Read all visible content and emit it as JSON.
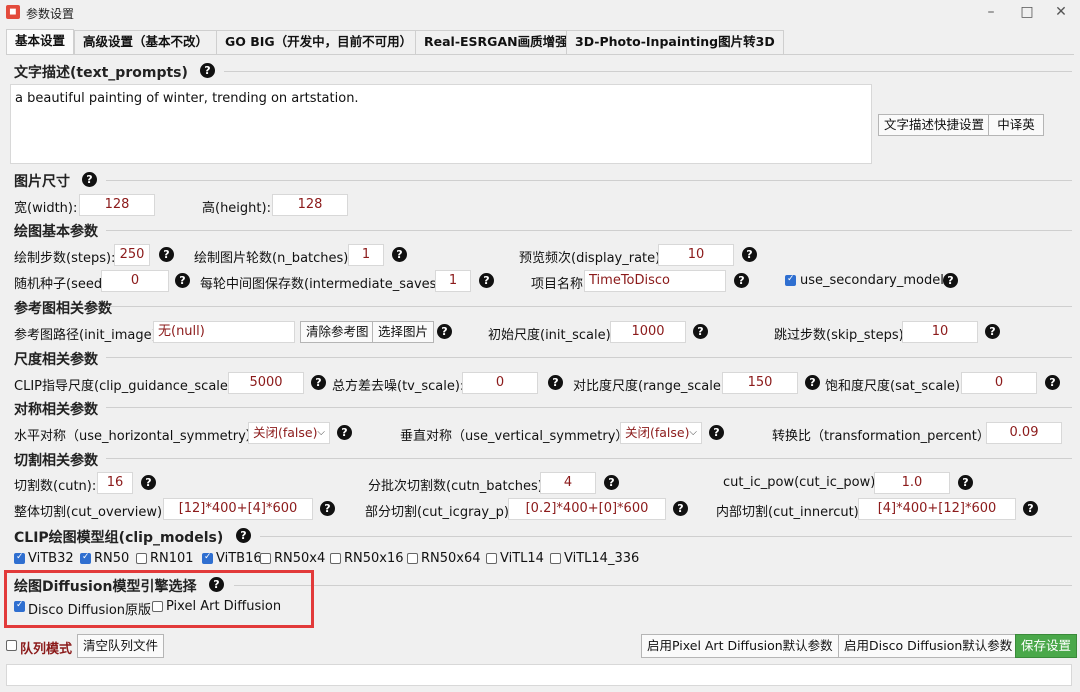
{
  "window": {
    "title": "参数设置"
  },
  "tabs": [
    {
      "label": "基本设置"
    },
    {
      "label": "高级设置（基本不改）"
    },
    {
      "label": "GO BIG（开发中，目前不可用）"
    },
    {
      "label": "Real-ESRGAN画质增强"
    },
    {
      "label": "3D-Photo-Inpainting图片转3D"
    }
  ],
  "text_prompts": {
    "title": "文字描述(text_prompts)",
    "value": "a beautiful painting of winter, trending on artstation.",
    "quick_btn": "文字描述快捷设置",
    "translate_btn": "中译英"
  },
  "image_size": {
    "title": "图片尺寸",
    "width_label": "宽(width):",
    "width": "128",
    "height_label": "高(height):",
    "height": "128"
  },
  "basic": {
    "title": "绘图基本参数",
    "steps_label": "绘制步数(steps):",
    "steps": "250",
    "n_batches_label": "绘制图片轮数(n_batches):",
    "n_batches": "1",
    "display_rate_label": "预览频次(display_rate):",
    "display_rate": "10",
    "seed_label": "随机种子(seed):",
    "seed": "0",
    "intermediate_label": "每轮中间图保存数(intermediate_saves):",
    "intermediate": "1",
    "project_label": "项目名称",
    "project": "TimeToDisco",
    "secondary_label": "use_secondary_model"
  },
  "init": {
    "title": "参考图相关参数",
    "path_label": "参考图路径(init_image):",
    "path": "无(null)",
    "clear_btn": "清除参考图",
    "select_btn": "选择图片",
    "scale_label": "初始尺度(init_scale):",
    "scale": "1000",
    "skip_label": "跳过步数(skip_steps):",
    "skip": "10"
  },
  "scales": {
    "title": "尺度相关参数",
    "clip_label": "CLIP指导尺度(clip_guidance_scale):",
    "clip": "5000",
    "tv_label": "总方差去噪(tv_scale):",
    "tv": "0",
    "range_label": "对比度尺度(range_scale):",
    "range": "150",
    "sat_label": "饱和度尺度(sat_scale):",
    "sat": "0"
  },
  "symmetry": {
    "title": "对称相关参数",
    "h_label": "水平对称（use_horizontal_symmetry）",
    "h_value": "关闭(false)",
    "v_label": "垂直对称（use_vertical_symmetry）",
    "v_value": "关闭(false)",
    "t_label": "转换比（transformation_percent）",
    "t_value": "0.09"
  },
  "cuts": {
    "title": "切割相关参数",
    "cutn_label": "切割数(cutn):",
    "cutn": "16",
    "batches_label": "分批次切割数(cutn_batches):",
    "batches": "4",
    "pow_label": "cut_ic_pow(cut_ic_pow):",
    "pow": "1.0",
    "overview_label": "整体切割(cut_overview):",
    "overview": "[12]*400+[4]*600",
    "icgray_label": "部分切割(cut_icgray_p):",
    "icgray": "[0.2]*400+[0]*600",
    "innercut_label": "内部切割(cut_innercut):",
    "innercut": "[4]*400+[12]*600"
  },
  "clip_models": {
    "title": "CLIP绘图模型组(clip_models)",
    "items": [
      {
        "label": "ViTB32",
        "checked": true
      },
      {
        "label": "RN50",
        "checked": true
      },
      {
        "label": "RN101",
        "checked": false
      },
      {
        "label": "ViTB16",
        "checked": true
      },
      {
        "label": "RN50x4",
        "checked": false
      },
      {
        "label": "RN50x16",
        "checked": false
      },
      {
        "label": "RN50x64",
        "checked": false
      },
      {
        "label": "ViTL14",
        "checked": false
      },
      {
        "label": "ViTL14_336",
        "checked": false
      }
    ]
  },
  "diffusion": {
    "title": "绘图Diffusion模型引擎选择",
    "disco_label": "Disco Diffusion原版",
    "disco_checked": true,
    "pixel_label": "Pixel Art Diffusion",
    "pixel_checked": false
  },
  "bottom": {
    "queue_label": "队列模式",
    "clear_queue_btn": "清空队列文件",
    "pixel_default_btn": "启用Pixel Art Diffusion默认参数",
    "disco_default_btn": "启用Disco Diffusion默认参数",
    "save_btn": "保存设置"
  },
  "colors": {
    "accent": "#2f6fd0",
    "save_green": "#4aa84a",
    "value_red": "#8b1a1a",
    "highlight": "#e23a3a"
  }
}
